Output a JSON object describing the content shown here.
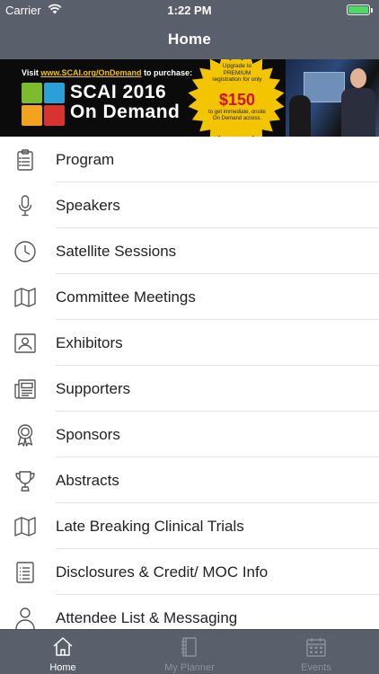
{
  "status_bar": {
    "carrier": "Carrier",
    "time": "1:22 PM",
    "battery_level": 1.0,
    "battery_color": "#4cd964"
  },
  "nav": {
    "title": "Home"
  },
  "banner": {
    "visit_prefix": "Visit",
    "visit_url": "www.SCAI.org/OnDemand",
    "visit_suffix": "to purchase:",
    "title_line1": "SCAI 2016",
    "title_line2": "On Demand",
    "burst_line1": "Upgrade to",
    "burst_line2": "PREMIUM",
    "burst_line3": "registration for only",
    "price": "$150",
    "burst_sub1": "to get immediate, onsite",
    "burst_sub2": "On Demand access.",
    "colors": {
      "background": "#0b0b0c",
      "starburst": "#f2c500",
      "price": "#d0101a",
      "logo": [
        "#7dbb2e",
        "#2a9fd8",
        "#f2a21e",
        "#d8342f"
      ]
    }
  },
  "menu": {
    "items": [
      {
        "label": "Program",
        "icon": "clipboard-icon"
      },
      {
        "label": "Speakers",
        "icon": "microphone-icon"
      },
      {
        "label": "Satellite Sessions",
        "icon": "clock-icon"
      },
      {
        "label": "Committee Meetings",
        "icon": "map-icon"
      },
      {
        "label": "Exhibitors",
        "icon": "exhibitor-icon"
      },
      {
        "label": "Supporters",
        "icon": "newspaper-icon"
      },
      {
        "label": "Sponsors",
        "icon": "ribbon-award-icon"
      },
      {
        "label": "Abstracts",
        "icon": "trophy-icon"
      },
      {
        "label": "Late Breaking Clinical Trials",
        "icon": "map-icon"
      },
      {
        "label": "Disclosures & Credit/ MOC Info",
        "icon": "list-icon"
      },
      {
        "label": "Attendee List & Messaging",
        "icon": "person-icon"
      }
    ]
  },
  "tabbar": {
    "tabs": [
      {
        "label": "Home",
        "icon": "house-icon",
        "active": true
      },
      {
        "label": "My Planner",
        "icon": "planner-icon",
        "active": false
      },
      {
        "label": "Events",
        "icon": "calendar-icon",
        "active": false
      }
    ]
  }
}
